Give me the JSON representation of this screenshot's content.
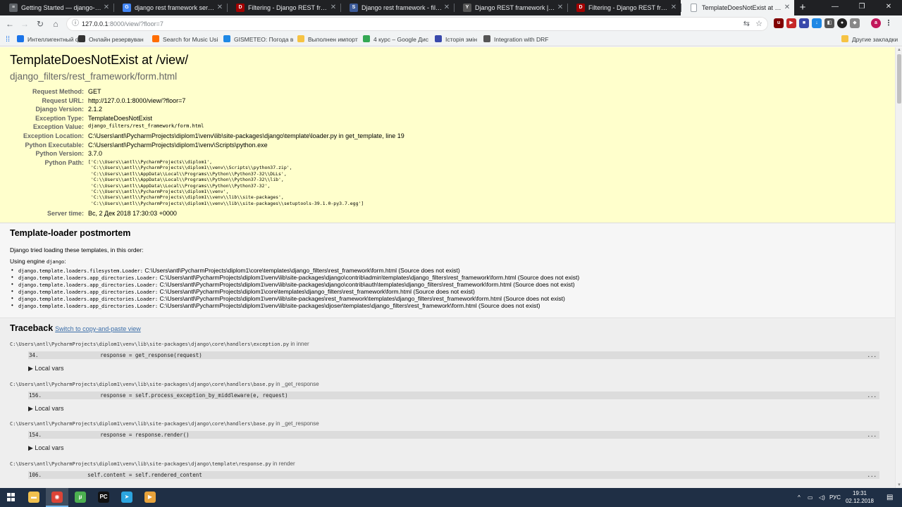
{
  "browser": {
    "tabs": [
      {
        "title": "Getting Started — django-filter 2",
        "icon_color": "#5f6368",
        "icon": "doc"
      },
      {
        "title": "django rest framework serializer",
        "icon_color": "#4285f4",
        "icon": "G"
      },
      {
        "title": "Filtering - Django REST framewo",
        "icon_color": "#a30000",
        "icon": "D"
      },
      {
        "title": "Django rest framework - filtering",
        "icon_color": "#3b5998",
        "icon": "S"
      },
      {
        "title": "Django REST framework | Filter i",
        "icon_color": "#555555",
        "icon": "Y"
      },
      {
        "title": "Filtering - Django REST framewo",
        "icon_color": "#a30000",
        "icon": "D"
      },
      {
        "title": "TemplateDoesNotExist at /view/",
        "icon_color": "#9aa0a6",
        "icon": "page",
        "active": true
      }
    ],
    "new_tab": "+",
    "window_controls": {
      "minimize": "—",
      "maximize": "❐",
      "close": "✕"
    },
    "url_host": "127.0.0.1",
    "url_rest": ":8000/view/?floor=7",
    "bookmarks": [
      {
        "label": "Интеллигентный фо",
        "color": "#1a73e8"
      },
      {
        "label": "Онлайн резервуван",
        "color": "#333333"
      },
      {
        "label": "Search for Music Usi",
        "color": "#ff6d00"
      },
      {
        "label": "GISMETEO: Погода в",
        "color": "#1e88e5"
      },
      {
        "label": "Выполнен импорт",
        "color": "#f6c344"
      },
      {
        "label": "4 курс – Google Дис",
        "color": "#34a853"
      },
      {
        "label": "Історія змін",
        "color": "#3949ab"
      },
      {
        "label": "Integration with DRF",
        "color": "#555555"
      }
    ],
    "other_bookmarks": "Другие закладки"
  },
  "error": {
    "title": "TemplateDoesNotExist at /view/",
    "subtitle": "django_filters/rest_framework/form.html",
    "meta": [
      {
        "key": "Request Method:",
        "value": "GET"
      },
      {
        "key": "Request URL:",
        "value": "http://127.0.0.1:8000/view/?floor=7"
      },
      {
        "key": "Django Version:",
        "value": "2.1.2"
      },
      {
        "key": "Exception Type:",
        "value": "TemplateDoesNotExist"
      },
      {
        "key": "Exception Value:",
        "value": "django_filters/rest_framework/form.html",
        "mono": true
      },
      {
        "key": "Exception Location:",
        "value": "C:\\Users\\antl\\PycharmProjects\\diplom1\\venv\\lib\\site-packages\\django\\template\\loader.py in get_template, line 19"
      },
      {
        "key": "Python Executable:",
        "value": "C:\\Users\\antl\\PycharmProjects\\diplom1\\venv\\Scripts\\python.exe"
      },
      {
        "key": "Python Version:",
        "value": "3.7.0"
      }
    ],
    "python_path_key": "Python Path:",
    "python_path": "['C:\\\\Users\\\\antl\\\\PycharmProjects\\\\diplom1',\n 'C:\\\\Users\\\\antl\\\\PycharmProjects\\\\diplom1\\\\venv\\\\Scripts\\\\python37.zip',\n 'C:\\\\Users\\\\antl\\\\AppData\\\\Local\\\\Programs\\\\Python\\\\Python37-32\\\\DLLs',\n 'C:\\\\Users\\\\antl\\\\AppData\\\\Local\\\\Programs\\\\Python\\\\Python37-32\\\\lib',\n 'C:\\\\Users\\\\antl\\\\AppData\\\\Local\\\\Programs\\\\Python\\\\Python37-32',\n 'C:\\\\Users\\\\antl\\\\PycharmProjects\\\\diplom1\\\\venv',\n 'C:\\\\Users\\\\antl\\\\PycharmProjects\\\\diplom1\\\\venv\\\\lib\\\\site-packages',\n 'C:\\\\Users\\\\antl\\\\PycharmProjects\\\\diplom1\\\\venv\\\\lib\\\\site-packages\\\\setuptools-39.1.0-py3.7.egg']",
    "server_time_key": "Server time:",
    "server_time": "Вс, 2 Дек 2018 17:30:03 +0000"
  },
  "postmortem": {
    "title": "Template-loader postmortem",
    "intro": "Django tried loading these templates, in this order:",
    "engine_prefix": "Using engine ",
    "engine": "django",
    "engine_suffix": ":",
    "loaders": [
      {
        "loader": "django.template.loaders.filesystem.Loader:",
        "path": "C:\\Users\\antl\\PycharmProjects\\diplom1\\core\\templates\\django_filters\\rest_framework\\form.html (Source does not exist)"
      },
      {
        "loader": "django.template.loaders.app_directories.Loader:",
        "path": "C:\\Users\\antl\\PycharmProjects\\diplom1\\venv\\lib\\site-packages\\django\\contrib\\admin\\templates\\django_filters\\rest_framework\\form.html (Source does not exist)"
      },
      {
        "loader": "django.template.loaders.app_directories.Loader:",
        "path": "C:\\Users\\antl\\PycharmProjects\\diplom1\\venv\\lib\\site-packages\\django\\contrib\\auth\\templates\\django_filters\\rest_framework\\form.html (Source does not exist)"
      },
      {
        "loader": "django.template.loaders.app_directories.Loader:",
        "path": "C:\\Users\\antl\\PycharmProjects\\diplom1\\core\\templates\\django_filters\\rest_framework\\form.html (Source does not exist)"
      },
      {
        "loader": "django.template.loaders.app_directories.Loader:",
        "path": "C:\\Users\\antl\\PycharmProjects\\diplom1\\venv\\lib\\site-packages\\rest_framework\\templates\\django_filters\\rest_framework\\form.html (Source does not exist)"
      },
      {
        "loader": "django.template.loaders.app_directories.Loader:",
        "path": "C:\\Users\\antl\\PycharmProjects\\diplom1\\venv\\lib\\site-packages\\djoser\\templates\\django_filters\\rest_framework\\form.html (Source does not exist)"
      }
    ]
  },
  "traceback": {
    "title": "Traceback",
    "switch_link": "Switch to copy-and-paste view",
    "local_vars_label": "▶ Local vars",
    "frames": [
      {
        "file": "C:\\Users\\antl\\PycharmProjects\\diplom1\\venv\\lib\\site-packages\\django\\core\\handlers\\exception.py",
        "in": " in ",
        "func": "inner",
        "line": "34.",
        "code": "                response = get_response(request)",
        "dots": "..."
      },
      {
        "file": "C:\\Users\\antl\\PycharmProjects\\diplom1\\venv\\lib\\site-packages\\django\\core\\handlers\\base.py",
        "in": " in ",
        "func": "_get_response",
        "line": "156.",
        "code": "                response = self.process_exception_by_middleware(e, request)",
        "dots": "..."
      },
      {
        "file": "C:\\Users\\antl\\PycharmProjects\\diplom1\\venv\\lib\\site-packages\\django\\core\\handlers\\base.py",
        "in": " in ",
        "func": "_get_response",
        "line": "154.",
        "code": "                response = response.render()",
        "dots": "..."
      },
      {
        "file": "C:\\Users\\antl\\PycharmProjects\\diplom1\\venv\\lib\\site-packages\\django\\template\\response.py",
        "in": " in ",
        "func": "render",
        "line": "106.",
        "code": "            self.content = self.rendered_content",
        "dots": "..."
      }
    ]
  },
  "taskbar": {
    "apps": [
      {
        "name": "file-explorer",
        "color": "#f2c14e",
        "glyph": "▬"
      },
      {
        "name": "chrome",
        "color": "#db4437",
        "glyph": "◉",
        "active": true
      },
      {
        "name": "utorrent",
        "color": "#4caf50",
        "glyph": "µ"
      },
      {
        "name": "pycharm",
        "color": "#111111",
        "glyph": "PC"
      },
      {
        "name": "telegram",
        "color": "#2ca5e0",
        "glyph": "➤"
      },
      {
        "name": "media-player",
        "color": "#e8a33b",
        "glyph": "▶"
      }
    ],
    "language": "РУС",
    "time": "19:31",
    "date": "02.12.2018"
  }
}
